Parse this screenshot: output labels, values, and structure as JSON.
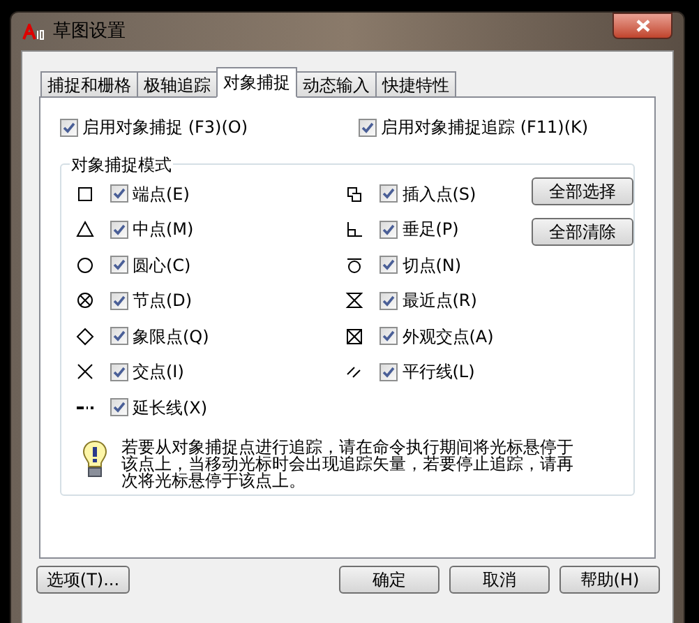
{
  "window": {
    "title": "草图设置"
  },
  "tabs": [
    {
      "label": "捕捉和栅格",
      "selected": false
    },
    {
      "label": "极轴追踪",
      "selected": false
    },
    {
      "label": "对象捕捉",
      "selected": true
    },
    {
      "label": "动态输入",
      "selected": false
    },
    {
      "label": "快捷特性",
      "selected": false
    }
  ],
  "top_options": [
    {
      "label": "启用对象捕捉 (F3)(O)",
      "checked": true
    },
    {
      "label": "启用对象捕捉追踪 (F11)(K)",
      "checked": true
    }
  ],
  "group": {
    "title": "对象捕捉模式",
    "left_column": [
      {
        "kind": "endpoint",
        "label": "端点(E)",
        "checked": true
      },
      {
        "kind": "midpoint",
        "label": "中点(M)",
        "checked": true
      },
      {
        "kind": "center",
        "label": "圆心(C)",
        "checked": true
      },
      {
        "kind": "node",
        "label": "节点(D)",
        "checked": true
      },
      {
        "kind": "quadrant",
        "label": "象限点(Q)",
        "checked": true
      },
      {
        "kind": "intersection",
        "label": "交点(I)",
        "checked": true
      },
      {
        "kind": "extension",
        "label": "延长线(X)",
        "checked": true
      }
    ],
    "right_column": [
      {
        "kind": "insertion",
        "label": "插入点(S)",
        "checked": true
      },
      {
        "kind": "perpendicular",
        "label": "垂足(P)",
        "checked": true
      },
      {
        "kind": "tangent",
        "label": "切点(N)",
        "checked": true
      },
      {
        "kind": "nearest",
        "label": "最近点(R)",
        "checked": true
      },
      {
        "kind": "apparent",
        "label": "外观交点(A)",
        "checked": true
      },
      {
        "kind": "parallel",
        "label": "平行线(L)",
        "checked": true
      }
    ],
    "buttons": [
      "全部选择",
      "全部清除"
    ],
    "hint": "若要从对象捕捉点进行追踪，请在命令执行期间将光标悬停于该点上，当移动光标时会出现追踪矢量，若要停止追踪，请再次将光标悬停于该点上。"
  },
  "footer": {
    "options_button": "选项(T)...",
    "buttons": [
      "确定",
      "取消",
      "帮助(H)"
    ]
  }
}
